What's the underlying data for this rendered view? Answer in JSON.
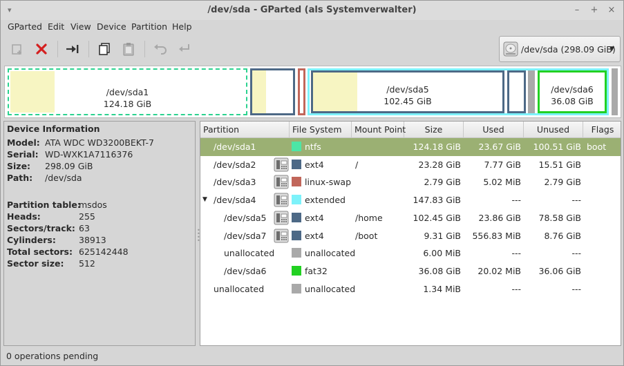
{
  "window": {
    "title": "/dev/sda - GParted (als Systemverwalter)",
    "controls": [
      "–",
      "+",
      "×"
    ]
  },
  "menu": [
    "GParted",
    "Edit",
    "View",
    "Device",
    "Partition",
    "Help"
  ],
  "device_selector": {
    "label": "/dev/sda   (298.09 GiB)"
  },
  "disk_map": [
    {
      "name": "/dev/sda1",
      "size": "124.18 GiB",
      "color": "#2bd28f"
    },
    {
      "name": "/dev/sda5",
      "size": "102.45 GiB",
      "color": "#4d6986"
    },
    {
      "name": "/dev/sda6",
      "size": "36.08 GiB",
      "color": "#22d122"
    }
  ],
  "device_info": {
    "heading": "Device Information",
    "rows1": [
      {
        "key": "Model:",
        "value": "ATA WDC WD3200BEKT-7"
      },
      {
        "key": "Serial:",
        "value": "WD-WXK1A7116376"
      },
      {
        "key": "Size:",
        "value": "298.09 GiB"
      },
      {
        "key": "Path:",
        "value": "/dev/sda"
      }
    ],
    "rows2": [
      {
        "key": "Partition table:",
        "value": "msdos"
      },
      {
        "key": "Heads:",
        "value": "255"
      },
      {
        "key": "Sectors/track:",
        "value": "63"
      },
      {
        "key": "Cylinders:",
        "value": "38913"
      },
      {
        "key": "Total sectors:",
        "value": "625142448"
      },
      {
        "key": "Sector size:",
        "value": "512"
      }
    ]
  },
  "table": {
    "columns": [
      "Partition",
      "File System",
      "Mount Point",
      "Size",
      "Used",
      "Unused",
      "Flags"
    ],
    "rows": [
      {
        "partition": "/dev/sda1",
        "fs": "ntfs",
        "fs_color": "#4ce6a6",
        "mount": "",
        "size": "124.18 GiB",
        "used": "23.67 GiB",
        "unused": "100.51 GiB",
        "flags": "boot",
        "locked": false,
        "indent": 0,
        "expander": false,
        "selected": true
      },
      {
        "partition": "/dev/sda2",
        "fs": "ext4",
        "fs_color": "#4d6986",
        "mount": "/",
        "size": "23.28 GiB",
        "used": "7.77 GiB",
        "unused": "15.51 GiB",
        "flags": "",
        "locked": true,
        "indent": 0,
        "expander": false,
        "selected": false
      },
      {
        "partition": "/dev/sda3",
        "fs": "linux-swap",
        "fs_color": "#c1665a",
        "mount": "",
        "size": "2.79 GiB",
        "used": "5.02 MiB",
        "unused": "2.79 GiB",
        "flags": "",
        "locked": true,
        "indent": 0,
        "expander": false,
        "selected": false
      },
      {
        "partition": "/dev/sda4",
        "fs": "extended",
        "fs_color": "#7df2fa",
        "mount": "",
        "size": "147.83 GiB",
        "used": "---",
        "unused": "---",
        "flags": "",
        "locked": true,
        "indent": 0,
        "expander": true,
        "selected": false
      },
      {
        "partition": "/dev/sda5",
        "fs": "ext4",
        "fs_color": "#4d6986",
        "mount": "/home",
        "size": "102.45 GiB",
        "used": "23.86 GiB",
        "unused": "78.58 GiB",
        "flags": "",
        "locked": true,
        "indent": 1,
        "expander": false,
        "selected": false
      },
      {
        "partition": "/dev/sda7",
        "fs": "ext4",
        "fs_color": "#4d6986",
        "mount": "/boot",
        "size": "9.31 GiB",
        "used": "556.83 MiB",
        "unused": "8.76 GiB",
        "flags": "",
        "locked": true,
        "indent": 1,
        "expander": false,
        "selected": false
      },
      {
        "partition": "unallocated",
        "fs": "unallocated",
        "fs_color": "#a9a9a9",
        "mount": "",
        "size": "6.00 MiB",
        "used": "---",
        "unused": "---",
        "flags": "",
        "locked": false,
        "indent": 1,
        "expander": false,
        "selected": false
      },
      {
        "partition": "/dev/sda6",
        "fs": "fat32",
        "fs_color": "#22d122",
        "mount": "",
        "size": "36.08 GiB",
        "used": "20.02 MiB",
        "unused": "36.06 GiB",
        "flags": "",
        "locked": false,
        "indent": 1,
        "expander": false,
        "selected": false
      },
      {
        "partition": "unallocated",
        "fs": "unallocated",
        "fs_color": "#a9a9a9",
        "mount": "",
        "size": "1.34 MiB",
        "used": "---",
        "unused": "---",
        "flags": "",
        "locked": false,
        "indent": 0,
        "expander": false,
        "selected": false
      }
    ]
  },
  "status": {
    "text": "0 operations pending"
  }
}
